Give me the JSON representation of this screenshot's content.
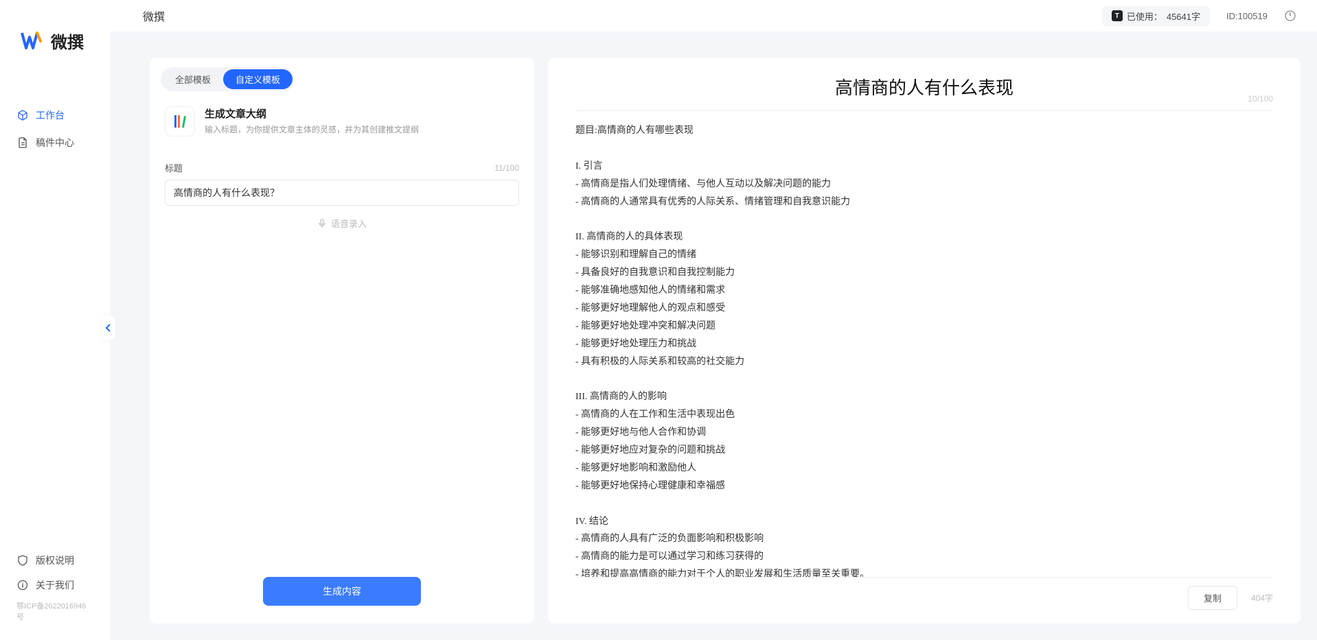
{
  "app": {
    "name": "微撰",
    "nav": [
      {
        "label": "工作台",
        "icon": "cube-icon",
        "active": true
      },
      {
        "label": "稿件中心",
        "icon": "doc-icon",
        "active": false
      }
    ],
    "footer_nav": [
      {
        "label": "版权说明",
        "icon": "shield-icon"
      },
      {
        "label": "关于我们",
        "icon": "info-icon"
      }
    ],
    "icp": "鄂ICP备2022016946号"
  },
  "topbar": {
    "title": "微撰",
    "usage_label": "已使用：",
    "usage_value": "45641字",
    "id_label": "ID:100519"
  },
  "left_panel": {
    "tabs": [
      {
        "label": "全部模板",
        "active": false
      },
      {
        "label": "自定义模板",
        "active": true
      }
    ],
    "template": {
      "title": "生成文章大纲",
      "desc": "输入标题，为你提供文章主体的灵感，并为其创建推文提纲"
    },
    "title_field": {
      "label": "标题",
      "value": "高情商的人有什么表现？",
      "count": "11/100"
    },
    "voice_hint": "语音录入",
    "generate_btn": "生成内容"
  },
  "right_panel": {
    "title": "高情商的人有什么表现",
    "title_count": "10/100",
    "body": "题目:高情商的人有哪些表现\n\nI. 引言\n- 高情商是指人们处理情绪、与他人互动以及解决问题的能力\n- 高情商的人通常具有优秀的人际关系、情绪管理和自我意识能力\n\nII. 高情商的人的具体表现\n- 能够识别和理解自己的情绪\n- 具备良好的自我意识和自我控制能力\n- 能够准确地感知他人的情绪和需求\n- 能够更好地理解他人的观点和感受\n- 能够更好地处理冲突和解决问题\n- 能够更好地处理压力和挑战\n- 具有积极的人际关系和较高的社交能力\n\nIII. 高情商的人的影响\n- 高情商的人在工作和生活中表现出色\n- 能够更好地与他人合作和协调\n- 能够更好地应对复杂的问题和挑战\n- 能够更好地影响和激励他人\n- 能够更好地保持心理健康和幸福感\n\nIV. 结论\n- 高情商的人具有广泛的负面影响和积极影响\n- 高情商的能力是可以通过学习和练习获得的\n- 培养和提高高情商的能力对于个人的职业发展和生活质量至关重要。",
    "copy_btn": "复制",
    "word_count": "404字"
  }
}
